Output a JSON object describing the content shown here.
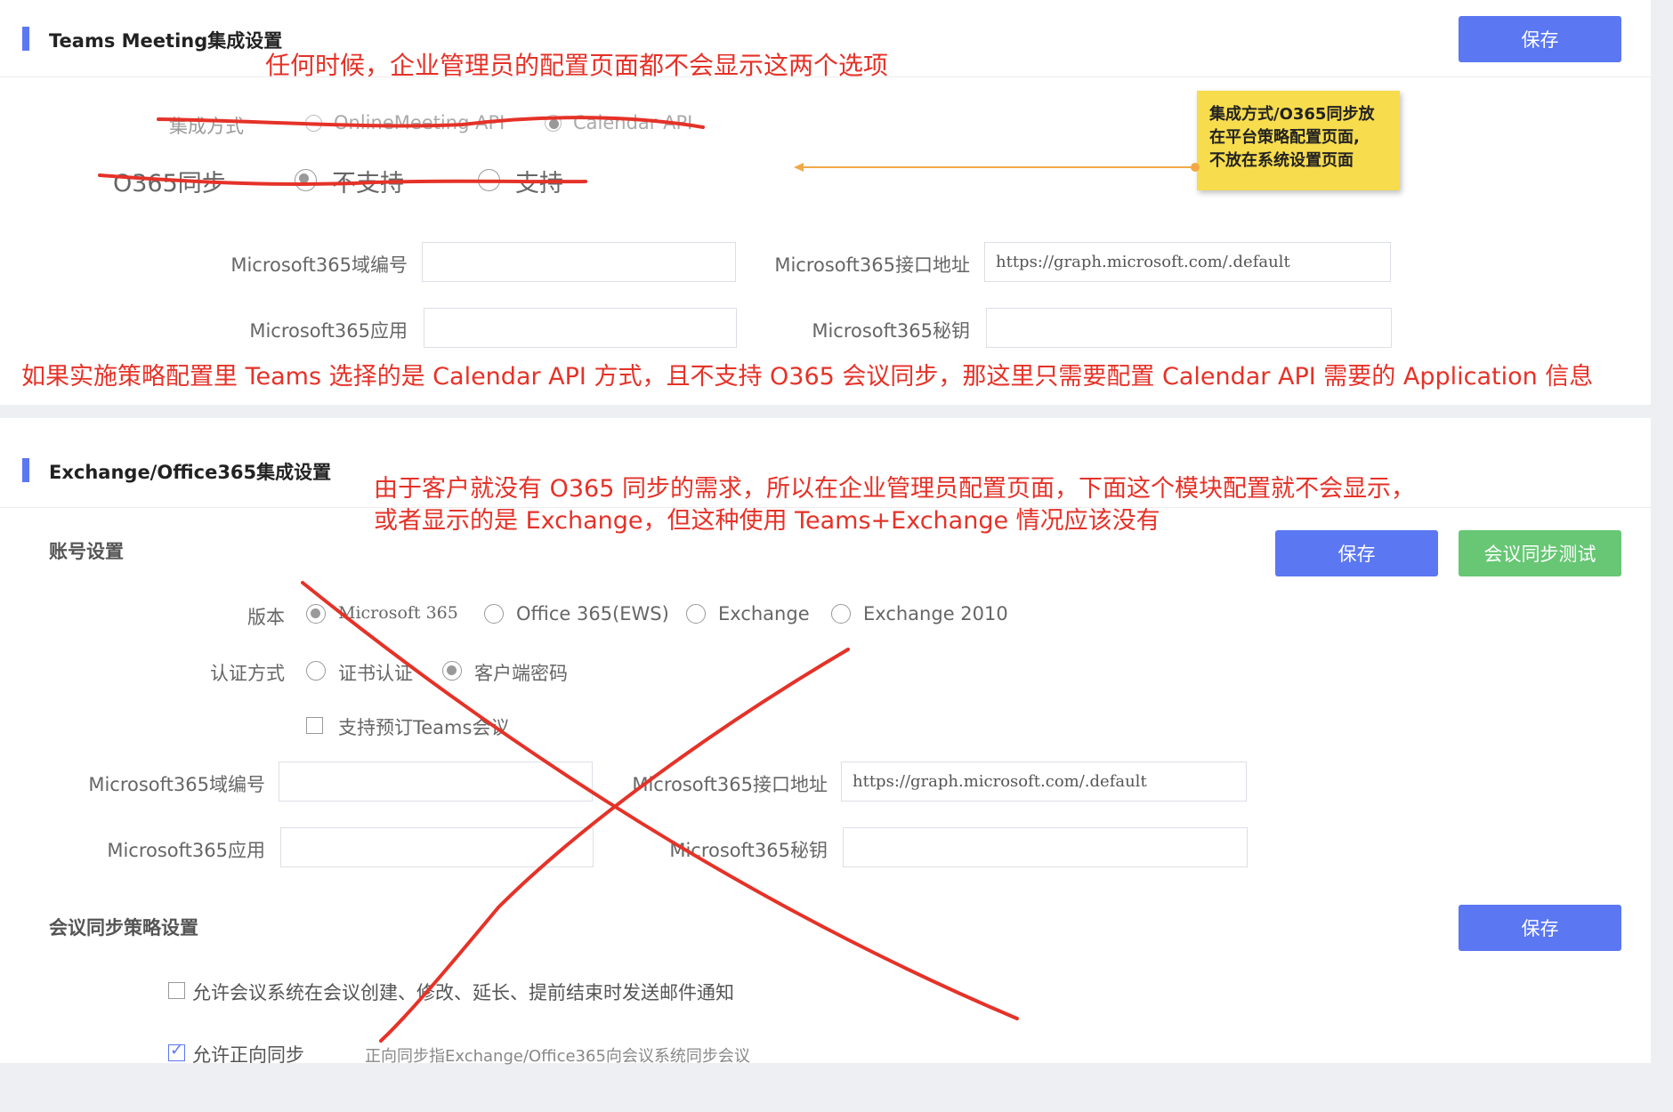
{
  "teams_section": {
    "title": "Teams Meeting集成设置",
    "save_label": "保存",
    "integration_mode_label": "集成方式",
    "integration_options": [
      "OnlineMeeting API",
      "Calendar API"
    ],
    "o365_sync_label": "O365同步",
    "o365_sync_options": [
      "不支持",
      "支持"
    ],
    "domain_label": "Microsoft365域编号",
    "domain_value": "",
    "endpoint_label": "Microsoft365接口地址",
    "endpoint_value": "https://graph.microsoft.com/.default",
    "app_label": "Microsoft365应用",
    "app_value": "",
    "secret_label": "Microsoft365秘钥",
    "secret_value": ""
  },
  "exchange_section": {
    "title": "Exchange/Office365集成设置",
    "account_settings_label": "账号设置",
    "save_label": "保存",
    "sync_test_label": "会议同步测试",
    "version_label": "版本",
    "version_options": [
      "Microsoft 365",
      "Office 365(EWS)",
      "Exchange",
      "Exchange 2010"
    ],
    "auth_label": "认证方式",
    "auth_options": [
      "证书认证",
      "客户端密码"
    ],
    "teams_booking_label": "支持预订Teams会议",
    "domain_label": "Microsoft365域编号",
    "domain_value": "",
    "endpoint_label": "Microsoft365接口地址",
    "endpoint_value": "https://graph.microsoft.com/.default",
    "app_label": "Microsoft365应用",
    "app_value": "",
    "secret_label": "Microsoft365秘钥",
    "secret_value": "",
    "sync_policy_label": "会议同步策略设置",
    "policy_save_label": "保存",
    "email_notify_label": "允许会议系统在会议创建、修改、延长、提前结束时发送邮件通知",
    "forward_sync_label": "允许正向同步",
    "forward_sync_hint": "正向同步指Exchange/Office365向会议系统同步会议"
  },
  "annotations": {
    "top_note": "任何时候，企业管理员的配置页面都不会显示这两个选项",
    "sticky_note": [
      "集成方式/O365同步放",
      "在平台策略配置页面,",
      "不放在系统设置页面"
    ],
    "calendar_note": "如果实施策略配置里 Teams 选择的是 Calendar API 方式，且不支持 O365 会议同步，那这里只需要配置 Calendar API 需要的 Application 信息",
    "exchange_note_1": "由于客户就没有 O365 同步的需求，所以在企业管理员配置页面，下面这个模块配置就不会显示，",
    "exchange_note_2": "或者显示的是 Exchange，但这种使用 Teams+Exchange 情况应该没有"
  },
  "colors": {
    "accent": "#5b77f2",
    "success": "#67c774",
    "annotation_red": "#e53228",
    "sticky_yellow": "#f7dc4d"
  }
}
